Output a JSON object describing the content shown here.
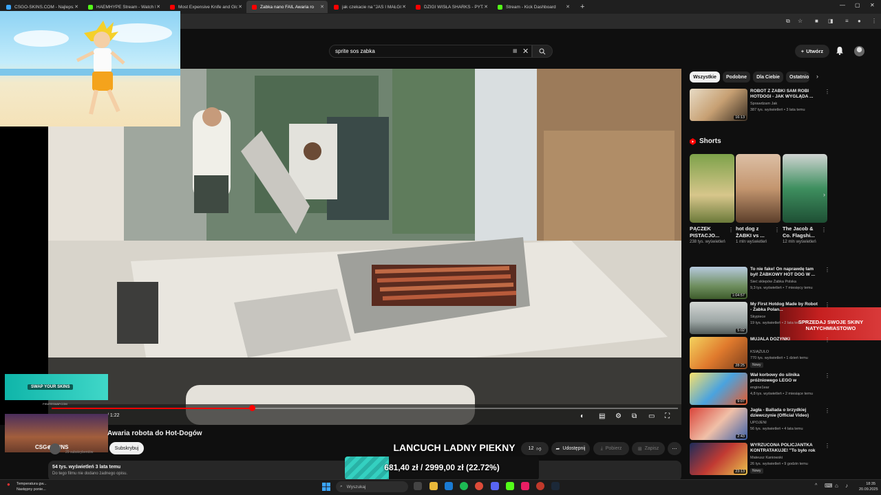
{
  "browser": {
    "tabs": [
      {
        "label": "CSGO-SKINS.COM - Najlepsze",
        "color": "#3ba6ff"
      },
      {
        "label": "HAEMHYPE Stream - Watch Live",
        "color": "#53fc18"
      },
      {
        "label": "Most Expensive Knife and Glov",
        "color": "#ff0000"
      },
      {
        "label": "Żabka nano FAIL Awaria ro",
        "color": "#ff0000"
      },
      {
        "label": "jak czekacie na \"JAŚ I MAŁGOS",
        "color": "#ff0000"
      },
      {
        "label": "DZIGI WISŁA SHARKS - PYTANI",
        "color": "#ff0000"
      },
      {
        "label": "Stream - Kick Dashboard",
        "color": "#53fc18"
      }
    ],
    "active_tab_index": 3
  },
  "youtube": {
    "search": {
      "value": "sprite sos zabka",
      "kb_icon": "keyboard-icon"
    },
    "create_label": "Utwórz"
  },
  "player": {
    "time": "/ 1:22",
    "progress_fraction": 0.32
  },
  "video": {
    "title": "Awaria robota do Hot-Dogów",
    "subscribe_label": "Subskrybuj",
    "subscribers": "29 subskrybentów",
    "share_label": "Udostępnij",
    "download_label": "Pobierz",
    "save_label": "Zapisz",
    "like_count": "12",
    "views_line": "54 tys. wyświetleń  3 lata temu",
    "description": "Do tego filmu nie dodano żadnego opisu."
  },
  "overlay": {
    "goal_title": "LANCUCH LADNY PIEKNY",
    "goal_text": "681,40 zł / 2999,00 zł (22.72%)",
    "goal_fraction": 0.2272,
    "swap_label": "SWAP YOUR SKINS",
    "swap_url": "PIRATESWAP.COM",
    "csgo_label": "CSG⊕SKINS",
    "sell_label": "SPRZEDAJ SWOJE SKINY NATYCHMIASTOWO"
  },
  "sidebar": {
    "chips": [
      "Wszystkie",
      "Podobne",
      "Dla Ciebie",
      "Ostatnio"
    ],
    "top_video": {
      "title": "ROBOT Z ŻABKI SAM ROBI HOTDOGI - JAK WYGLĄDA ...",
      "channel": "Sprawdzam Jak",
      "views": "387 tys. wyświetleń • 3 lata temu",
      "duration": "16:13"
    },
    "shorts_label": "Shorts",
    "shorts": [
      {
        "title": "PĄCZEK PISTACJO...",
        "views": "238 tys. wyświetleń"
      },
      {
        "title": "hot dog z ŻABKI vs ...",
        "views": "1 mln wyświetleń"
      },
      {
        "title": "The Jacob & Co. Flagshi...",
        "views": "12 mln wyświetleń"
      }
    ],
    "videos": [
      {
        "title": "To nie fake! On naprawdę tam był! ŻABKOWY HOT DOG W ...",
        "channel": "Sieć sklepów Żabka Polska",
        "views": "9,3 tys. wyświetleń • 7 miesięcy temu",
        "duration": "1:04:57",
        "badge": ""
      },
      {
        "title": "My First Hotdog Made by Robot - Żabka Polan...",
        "channel": "Skypiece",
        "views": "19 tys. wyświetleń • 2 lata temu",
        "duration": "5:02",
        "badge": ""
      },
      {
        "title": "MUJALA DOŻYNKI",
        "channel": "KSIĄŻULO",
        "views": "770 tys. wyświetleń • 1 dzień temu",
        "duration": "28:25",
        "badge": "Nowy"
      },
      {
        "title": "Wał korbowy do silnika próżniowego LEGO w naturaln...",
        "channel": "engine1ear",
        "views": "4,8 tys. wyświetleń • 2 miesiące temu",
        "duration": "9:07",
        "badge": ""
      },
      {
        "title": "Jagła - Ballada o brzydkiej dziewczynie (Official Video)",
        "channel": "UPOJENI",
        "views": "56 tys. wyświetleń • 4 lata temu",
        "duration": "2:43",
        "badge": ""
      },
      {
        "title": "WYRZUCONA POLICJANTKA KONTRATAKUJE! \"To było rok ...",
        "channel": "Mateusz Kaniowski",
        "views": "26 tys. wyświetleń • 9 godzin temu",
        "duration": "23:13",
        "badge": "Nowy"
      }
    ]
  },
  "taskbar": {
    "weather_line1": "Temperatura gw...",
    "weather_line2": "Następny ponie...",
    "search_placeholder": "Wyszukaj",
    "time": "18:35",
    "date": "20.09.2025"
  },
  "colors": {
    "accent": "#ff0000",
    "bg": "#0f0f0f",
    "chip": "#272727",
    "goal": "#34d0c0"
  }
}
